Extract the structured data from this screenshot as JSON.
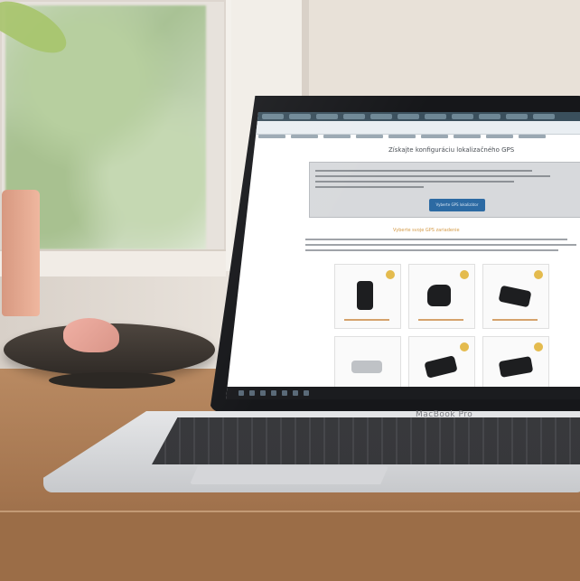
{
  "screen": {
    "page_title": "Získajte konfiguráciu lokalizačného GPS",
    "cta_label": "Vyberte GPS lokalizátor",
    "sub_title": "Vyberte svoje GPS zariadenie"
  },
  "laptop": {
    "brand": "MacBook Pro"
  },
  "colors": {
    "accent_button": "#2c6aa3",
    "badge": "#e4bb4e",
    "tabbar": "#3a4f5c"
  }
}
